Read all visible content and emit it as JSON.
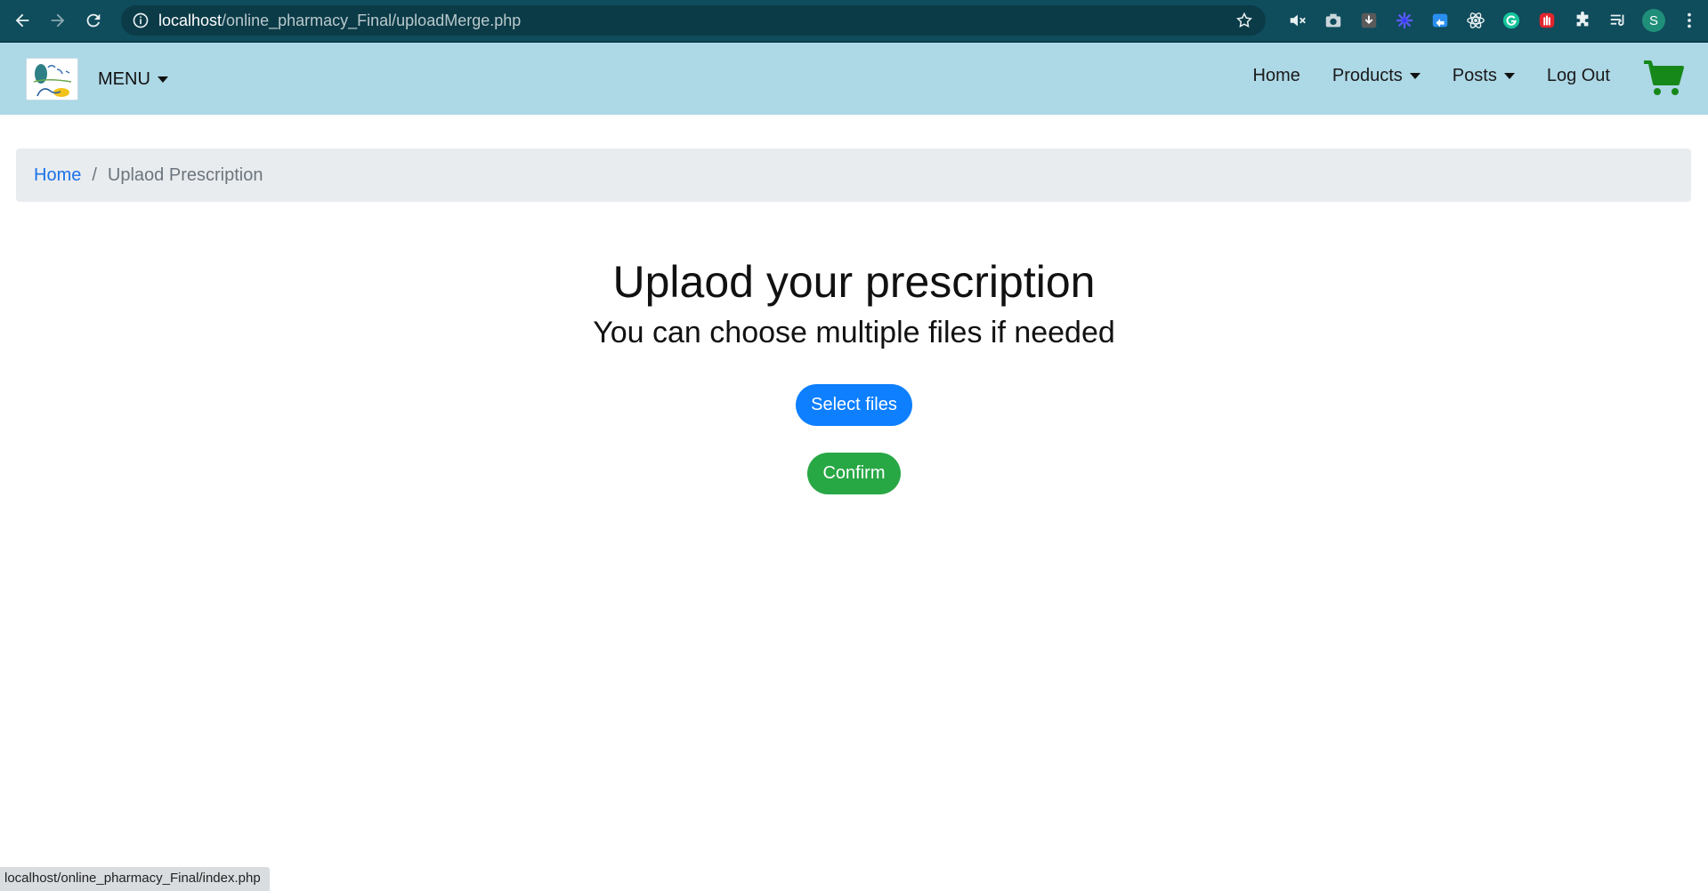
{
  "browser": {
    "url_host": "localhost",
    "url_path": "/online_pharmacy_Final/uploadMerge.php",
    "profile_initial": "S",
    "icons": {
      "back": "back-arrow-icon",
      "forward": "forward-arrow-icon",
      "reload": "reload-icon",
      "info": "info-icon",
      "bookmark": "star-icon",
      "extensions": [
        "mute-icon",
        "camera-icon",
        "download-icon",
        "flower-icon",
        "cast-icon",
        "atom-icon",
        "grammarly-icon",
        "hand-stop-icon",
        "puzzle-icon",
        "reading-list-icon",
        "avatar",
        "more-vert-icon"
      ]
    },
    "status_url": "localhost/online_pharmacy_Final/index.php"
  },
  "navbar": {
    "menu_label": "MENU",
    "links": {
      "home": "Home",
      "products": "Products",
      "posts": "Posts",
      "logout": "Log Out"
    },
    "cart_icon": "shopping-cart-icon",
    "colors": {
      "background": "#add8e6",
      "cart": "#16881a"
    }
  },
  "breadcrumb": {
    "home": "Home",
    "separator": "/",
    "current": "Uplaod Prescription"
  },
  "main": {
    "title": "Uplaod your prescription",
    "subtitle": "You can choose multiple files if needed",
    "select_button": "Select files",
    "confirm_button": "Confirm",
    "colors": {
      "select": "#0d7fff",
      "confirm": "#28a745"
    }
  }
}
